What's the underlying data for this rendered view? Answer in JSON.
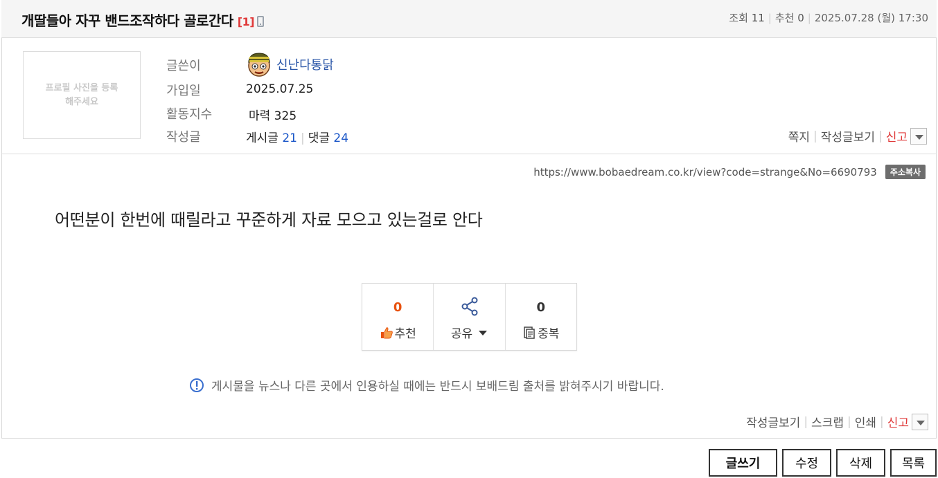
{
  "post": {
    "title": "개딸들아 자꾸 밴드조작하다 골로간다",
    "comment_count": "[1]",
    "views_label": "조회",
    "views": "11",
    "recommend_label": "추천",
    "recommend": "0",
    "datetime": "2025.07.28 (월) 17:30"
  },
  "author": {
    "profile_placeholder": "프로필 사진을 등록해주세요",
    "writer_label": "글쓴이",
    "nickname": "신난다통닭",
    "joined_label": "가입일",
    "joined": "2025.07.25",
    "activity_label": "활동지수",
    "activity": "마력 325",
    "posts_label": "작성글",
    "posts_text": "게시글",
    "posts_count": "21",
    "comments_text": "댓글",
    "comments_count": "24",
    "actions": {
      "message": "쪽지",
      "view_posts": "작성글보기",
      "report": "신고"
    }
  },
  "url": {
    "text": "https://www.bobaedream.co.kr/view?code=strange&No=6690793",
    "copy_label": "주소복사"
  },
  "body": {
    "text": "어떤분이 한번에 때릴라고 꾸준하게 자료 모으고 있는걸로 안다"
  },
  "reactions": {
    "recommend_count": "0",
    "recommend_label": "추천",
    "share_label": "공유",
    "duplicate_count": "0",
    "duplicate_label": "중복"
  },
  "notice": {
    "text": "게시물을 뉴스나 다른 곳에서 인용하실 때에는 반드시 보배드림 출처를 밝혀주시기 바랍니다."
  },
  "bottom_actions": {
    "view_posts": "작성글보기",
    "scrap": "스크랩",
    "print": "인쇄",
    "report": "신고"
  },
  "buttons": {
    "write": "글쓰기",
    "edit": "수정",
    "delete": "삭제",
    "list": "목록"
  },
  "colors": {
    "accent_red": "#e03a3a",
    "link_blue": "#1a56c8",
    "recommend_orange": "#e8520f"
  }
}
